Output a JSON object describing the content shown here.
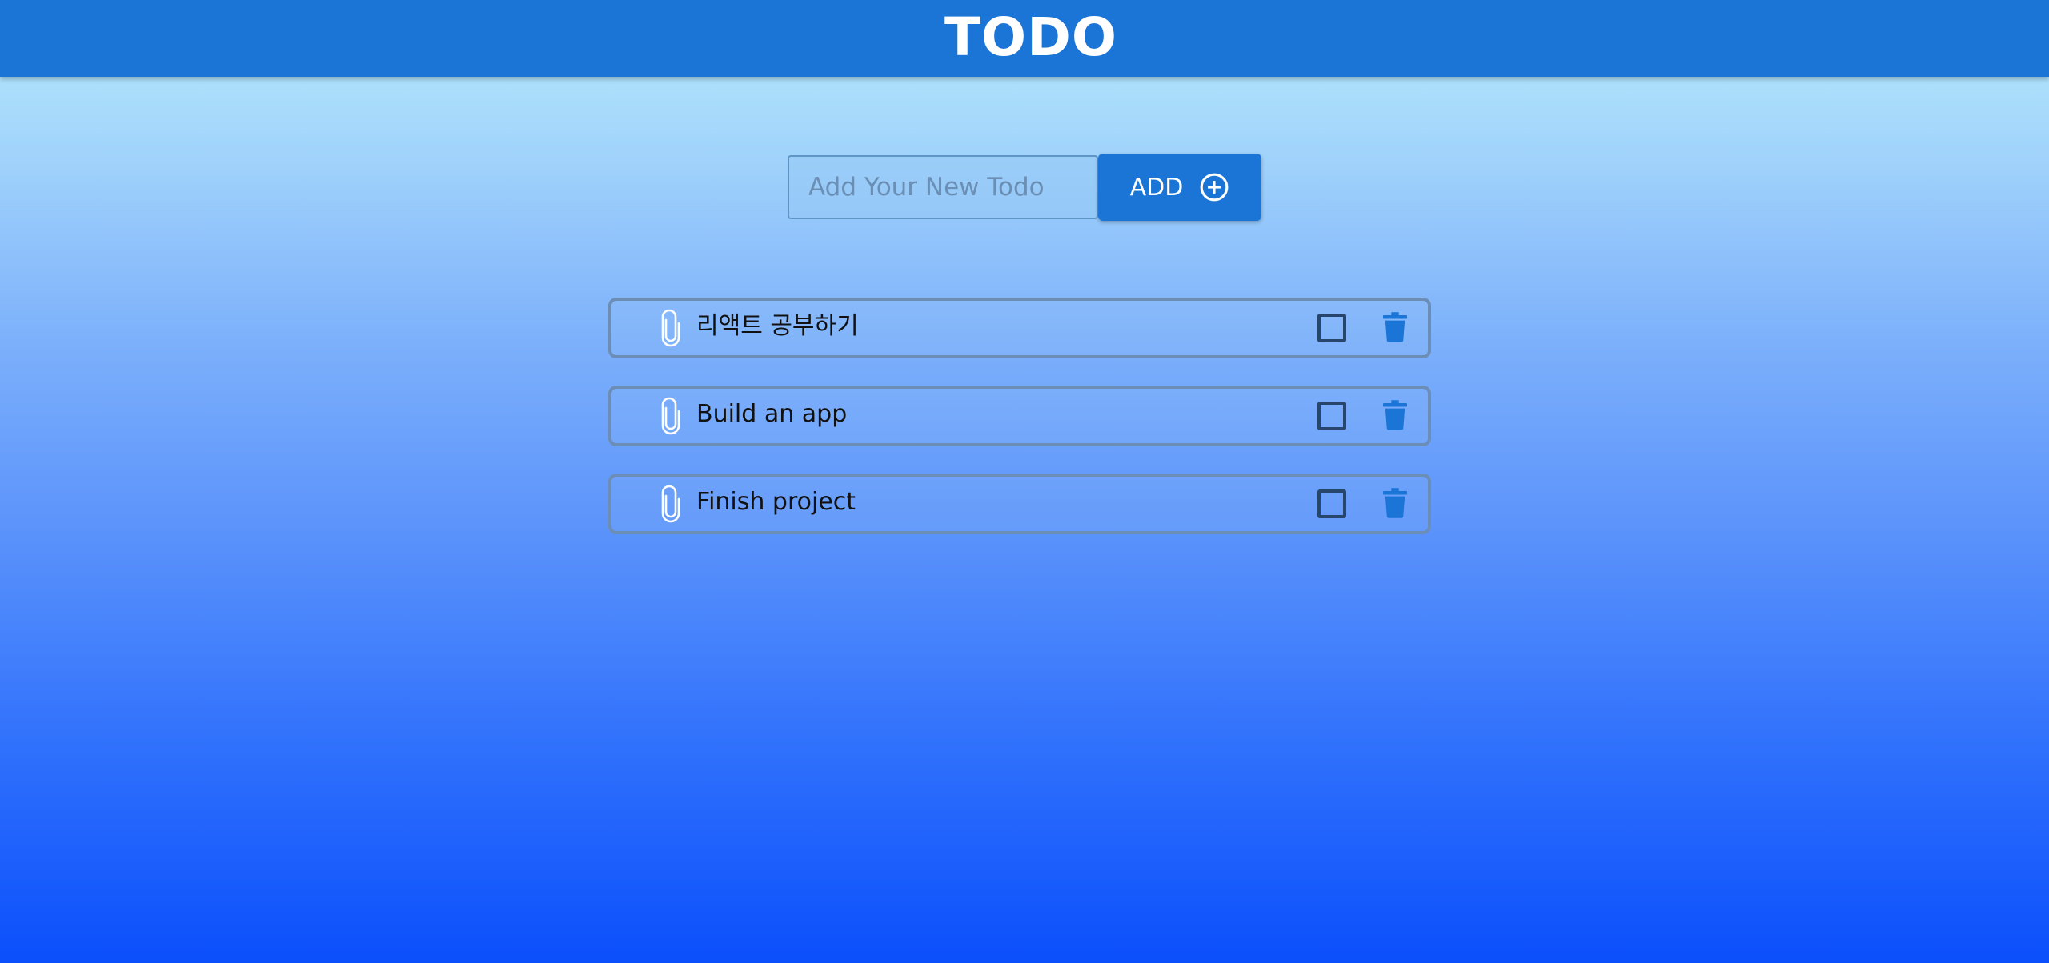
{
  "header": {
    "title": "TODO"
  },
  "form": {
    "input_placeholder": "Add Your New Todo",
    "input_value": "",
    "add_label": "ADD",
    "add_icon": "plus-circle-icon"
  },
  "todos": [
    {
      "text": "리액트 공부하기",
      "completed": false,
      "icon": "paperclip-icon"
    },
    {
      "text": "Build an app",
      "completed": false,
      "icon": "paperclip-icon"
    },
    {
      "text": "Finish project",
      "completed": false,
      "icon": "paperclip-icon"
    }
  ],
  "colors": {
    "accent": "#1a75d6",
    "checkbox_border": "#28456b",
    "item_border": "#6c8db6",
    "background_top": "#b8edfb",
    "background_bottom": "#0b4ffc"
  }
}
